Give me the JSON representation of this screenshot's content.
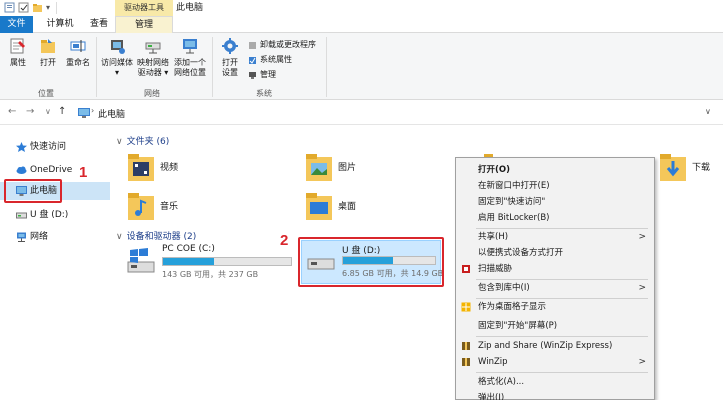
{
  "titlebar": {
    "context_header": "驱动器工具",
    "window_title": "此电脑"
  },
  "tabs": {
    "file": "文件",
    "computer": "计算机",
    "view": "查看",
    "manage": "管理"
  },
  "ribbon": {
    "properties": "属性",
    "open": "打开",
    "rename": "重命名",
    "group_location": "位置",
    "access_media": "访问媒体",
    "map_drive_l1": "映射网络",
    "map_drive_l2": "驱动器",
    "add_netloc_l1": "添加一个",
    "add_netloc_l2": "网络位置",
    "group_network": "网络",
    "open_settings_l1": "打开",
    "open_settings_l2": "设置",
    "uninstall": "卸载或更改程序",
    "sys_props": "系统属性",
    "manage": "管理",
    "group_system": "系统"
  },
  "address": {
    "back": "←",
    "forward": "→",
    "recent": "∨",
    "up": "↑",
    "path": "此电脑"
  },
  "sidebar": {
    "items": [
      {
        "label": "快速访问"
      },
      {
        "label": "OneDrive"
      },
      {
        "label": "此电脑"
      },
      {
        "label": "U 盘 (D:)"
      },
      {
        "label": "网络"
      }
    ],
    "annotation": "1"
  },
  "content": {
    "folders_header": "文件夹 (6)",
    "folders": [
      {
        "label": "视频"
      },
      {
        "label": "图片"
      },
      {
        "label": "下载"
      },
      {
        "label": "音乐"
      },
      {
        "label": "桌面"
      }
    ],
    "devices_header": "设备和驱动器 (2)",
    "drives": [
      {
        "name": "PC COE (C:)",
        "info": "143 GB 可用，共 237 GB",
        "used_fraction": 0.4
      },
      {
        "name": "U 盘 (D:)",
        "info": "6.85 GB 可用，共 14.9 GB",
        "used_fraction": 0.54
      }
    ],
    "annotation": "2"
  },
  "context_menu": {
    "items": [
      {
        "label": "打开(O)"
      },
      {
        "label": "在新窗口中打开(E)"
      },
      {
        "label": "固定到\"快速访问\""
      },
      {
        "label": "启用 BitLocker(B)"
      },
      {
        "label": "共享(H)"
      },
      {
        "label": "以便携式设备方式打开"
      },
      {
        "label": "扫描威胁"
      },
      {
        "label": "包含到库中(I)"
      },
      {
        "label": "作为桌面格子显示"
      },
      {
        "label": "固定到\"开始\"屏幕(P)"
      },
      {
        "label": "Zip and Share (WinZip Express)"
      },
      {
        "label": "WinZip"
      },
      {
        "label": "格式化(A)..."
      },
      {
        "label": "弹出(J)"
      }
    ],
    "submenu_arrow": ">"
  }
}
